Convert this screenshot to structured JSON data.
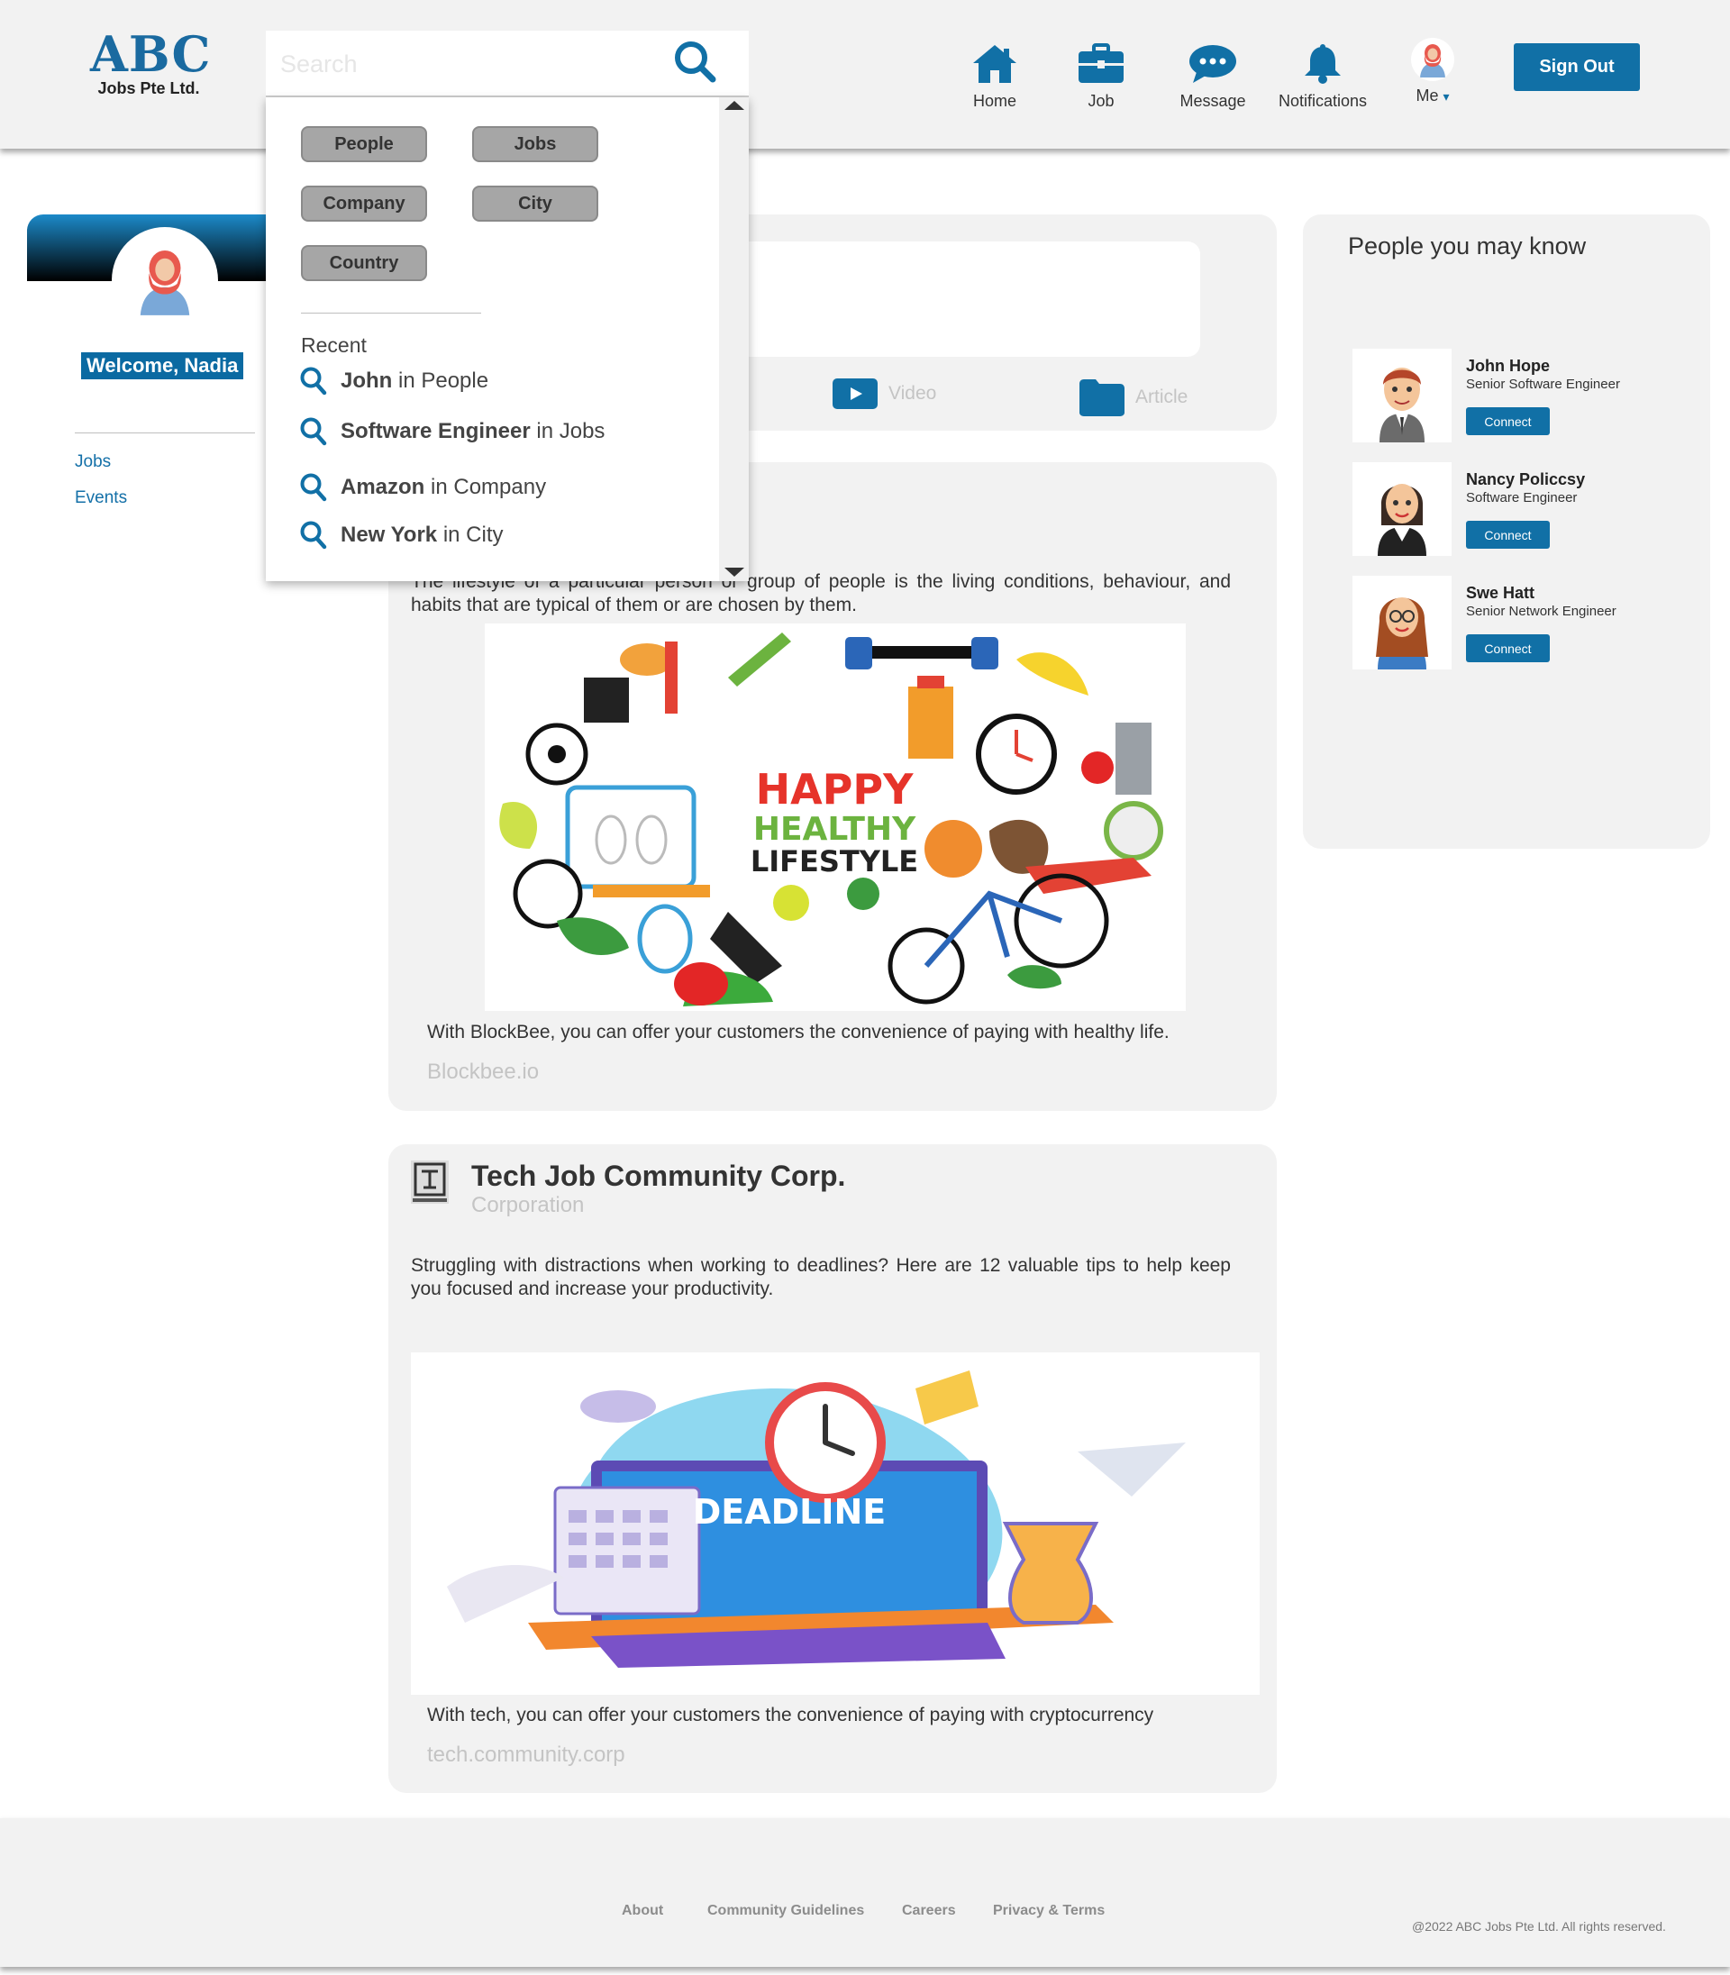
{
  "header": {
    "logo_main": "ABC",
    "logo_sub": "Jobs Pte Ltd.",
    "search_placeholder": "Search",
    "nav": [
      {
        "label": "Home",
        "icon": "home-icon"
      },
      {
        "label": "Job",
        "icon": "briefcase-icon"
      },
      {
        "label": "Message",
        "icon": "chat-icon"
      },
      {
        "label": "Notifications",
        "icon": "bell-icon"
      },
      {
        "label": "Me",
        "icon": "avatar"
      }
    ],
    "me_caret": "▾",
    "signout_label": "Sign Out"
  },
  "search_dropdown": {
    "chips": [
      "People",
      "Jobs",
      "Company",
      "City",
      "Country"
    ],
    "recent_title": "Recent",
    "recent": [
      {
        "term": "John",
        "scope": " in People"
      },
      {
        "term": "Software Engineer",
        "scope": " in Jobs"
      },
      {
        "term": "Amazon",
        "scope": " in Company"
      },
      {
        "term": "New York",
        "scope": " in City"
      }
    ]
  },
  "sidebar": {
    "welcome": "Welcome, Nadia",
    "links": [
      "Jobs",
      "Events"
    ]
  },
  "composer": {
    "video_label": "Video",
    "article_label": "Article"
  },
  "posts": [
    {
      "text": "The lifestyle of a particular person or group of people is the living conditions, behaviour, and habits that are typical of them or are chosen by them.",
      "image_text": [
        "HAPPY",
        "HEALTHY",
        "LIFESTYLE"
      ],
      "caption": "With BlockBee, you can offer your customers the convenience of paying with healthy life.",
      "link": "Blockbee.io"
    },
    {
      "company": "Tech Job Community Corp.",
      "type": "Corporation",
      "text": "Struggling with distractions when working to deadlines? Here are 12 valuable tips to help keep you focused and increase your productivity.",
      "image_text": "DEADLINE",
      "caption": "With tech, you can offer your customers the convenience of paying with cryptocurrency",
      "link": "tech.community.corp"
    }
  ],
  "pymk": {
    "title": "People you may know",
    "connect_label": "Connect",
    "people": [
      {
        "name": "John Hope",
        "role": "Senior Software Engineer"
      },
      {
        "name": "Nancy Policcsy",
        "role": "Software Engineer"
      },
      {
        "name": "Swe Hatt",
        "role": "Senior Network Engineer"
      }
    ]
  },
  "footer": {
    "links": [
      "About",
      "Community Guidelines",
      "Careers",
      "Privacy & Terms"
    ],
    "copyright": "@2022 ABC Jobs Pte Ltd. All rights reserved."
  },
  "colors": {
    "brand_blue": "#1170a6",
    "chip_gray": "#a6a6a6",
    "panel_gray": "#f2f2f2"
  }
}
